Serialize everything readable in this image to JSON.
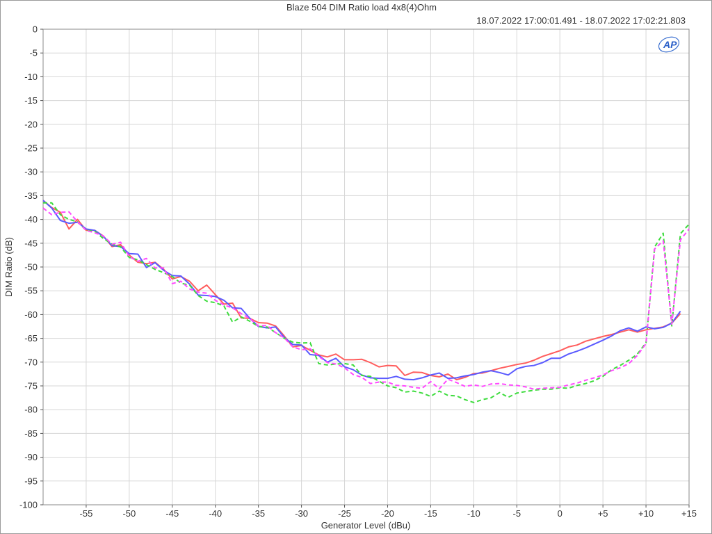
{
  "chart_data": {
    "type": "line",
    "title": "Blaze 504 DIM Ratio load 4x8(4)Ohm",
    "subtitle": "18.07.2022 17:00:01.491 - 18.07.2022 17:02:21.803",
    "xlabel": "Generator Level (dBu)",
    "ylabel": "DIM Ratio (dB)",
    "xlim": [
      -60,
      15
    ],
    "ylim": [
      -100,
      0
    ],
    "grid": true,
    "xticks": [
      -55,
      -50,
      -45,
      -40,
      -35,
      -30,
      -25,
      -20,
      -15,
      -10,
      -5,
      0,
      5,
      10,
      15
    ],
    "xtick_labels": [
      "-55",
      "-50",
      "-45",
      "-40",
      "-35",
      "-30",
      "-25",
      "-20",
      "-15",
      "-10",
      "-5",
      "0",
      "+5",
      "+10",
      "+15"
    ],
    "yticks": [
      0,
      -5,
      -10,
      -15,
      -20,
      -25,
      -30,
      -35,
      -40,
      -45,
      -50,
      -55,
      -60,
      -65,
      -70,
      -75,
      -80,
      -85,
      -90,
      -95,
      -100
    ],
    "ytick_labels": [
      "0",
      "-5",
      "-10",
      "-15",
      "-20",
      "-25",
      "-30",
      "-35",
      "-40",
      "-45",
      "-50",
      "-55",
      "-60",
      "-65",
      "-70",
      "-75",
      "-80",
      "-85",
      "-90",
      "-95",
      "-100"
    ],
    "series": [
      {
        "color": "#ff5d5d",
        "dash": false,
        "x": [
          -60,
          -59,
          -58,
          -57,
          -56,
          -55,
          -54,
          -53,
          -52,
          -51,
          -50,
          -49,
          -48,
          -47,
          -46,
          -45,
          -44,
          -43,
          -42,
          -41,
          -40,
          -39,
          -38,
          -37,
          -36,
          -35,
          -34,
          -33,
          -32,
          -31,
          -30,
          -29,
          -28,
          -27,
          -26,
          -25,
          -24,
          -23,
          -22,
          -21,
          -20,
          -19,
          -18,
          -17,
          -16,
          -15,
          -14,
          -13,
          -12,
          -11,
          -10,
          -9,
          -8,
          -7,
          -6,
          -5,
          -4,
          -3,
          -2,
          -1,
          0,
          1,
          2,
          3,
          4,
          5,
          6,
          7,
          8,
          9,
          10,
          11,
          12,
          13,
          14
        ],
        "y": [
          -36,
          -37.5,
          -38.5,
          -42,
          -40,
          -42.3,
          -42.3,
          -43.5,
          -45.7,
          -45.3,
          -47.5,
          -49,
          -49.3,
          -49,
          -50.5,
          -52.5,
          -52,
          -53,
          -55,
          -53.8,
          -55.8,
          -57.8,
          -57.6,
          -60.7,
          -60.8,
          -61.7,
          -61.8,
          -62.4,
          -64.5,
          -66.8,
          -66.5,
          -67.5,
          -68.5,
          -68.9,
          -68.3,
          -69.5,
          -69.5,
          -69.4,
          -70.1,
          -71,
          -70.7,
          -70.8,
          -72.8,
          -72.1,
          -72.2,
          -72.8,
          -73.1,
          -72.5,
          -73.7,
          -73.2,
          -72.4,
          -72.3,
          -71.8,
          -71.3,
          -70.9,
          -70.5,
          -70.2,
          -69.6,
          -68.8,
          -68.2,
          -67.6,
          -66.8,
          -66.4,
          -65.6,
          -65.1,
          -64.6,
          -64.2,
          -63.7,
          -63.2,
          -63.7,
          -63.2,
          -62.9,
          -62.6,
          -61.8,
          -59.8
        ]
      },
      {
        "color": "#5b5bff",
        "dash": false,
        "x": [
          -60,
          -59,
          -58,
          -57,
          -56,
          -55,
          -54,
          -53,
          -52,
          -51,
          -50,
          -49,
          -48,
          -47,
          -46,
          -45,
          -44,
          -43,
          -42,
          -41,
          -40,
          -39,
          -38,
          -37,
          -36,
          -35,
          -34,
          -33,
          -32,
          -31,
          -30,
          -29,
          -28,
          -27,
          -26,
          -25,
          -24,
          -23,
          -22,
          -21,
          -20,
          -19,
          -18,
          -17,
          -16,
          -15,
          -14,
          -13,
          -12,
          -11,
          -10,
          -9,
          -8,
          -7,
          -6,
          -5,
          -4,
          -3,
          -2,
          -1,
          0,
          1,
          2,
          3,
          4,
          5,
          6,
          7,
          8,
          9,
          10,
          11,
          12,
          13,
          14
        ],
        "y": [
          -36,
          -37.6,
          -40.2,
          -40.8,
          -40.6,
          -42,
          -42.3,
          -43.6,
          -45.5,
          -45.7,
          -47.2,
          -47.3,
          -50.1,
          -49.1,
          -50.7,
          -51.8,
          -51.9,
          -53.6,
          -55.9,
          -56,
          -56.2,
          -57,
          -58.6,
          -58.7,
          -60.8,
          -62.5,
          -62.8,
          -62.6,
          -64.8,
          -66.3,
          -66.4,
          -68.4,
          -68.6,
          -70,
          -69.2,
          -71,
          -71.6,
          -72.7,
          -73.3,
          -73.4,
          -73.4,
          -73,
          -73.6,
          -73.7,
          -73.3,
          -72.7,
          -72.3,
          -73.4,
          -73.3,
          -72.9,
          -72.6,
          -72.1,
          -71.8,
          -72.2,
          -72.7,
          -71.4,
          -70.9,
          -70.7,
          -70.1,
          -69.2,
          -69.2,
          -68.3,
          -67.7,
          -67,
          -66.2,
          -65.4,
          -64.5,
          -63.4,
          -62.8,
          -63.5,
          -62.6,
          -63,
          -62.7,
          -61.8,
          -59.3
        ]
      },
      {
        "color": "#3ddc3d",
        "dash": true,
        "x": [
          -60,
          -59,
          -58,
          -57,
          -56,
          -55,
          -54,
          -53,
          -52,
          -51,
          -50,
          -49,
          -48,
          -47,
          -46,
          -45,
          -44,
          -43,
          -42,
          -41,
          -40,
          -39,
          -38,
          -37,
          -36,
          -35,
          -34,
          -33,
          -32,
          -31,
          -30,
          -29,
          -28,
          -27,
          -26,
          -25,
          -24,
          -23,
          -22,
          -21,
          -20,
          -19,
          -18,
          -17,
          -16,
          -15,
          -14,
          -13,
          -12,
          -11,
          -10,
          -9,
          -8,
          -7,
          -6,
          -5,
          -4,
          -3,
          -2,
          -1,
          0,
          1,
          2,
          3,
          4,
          5,
          6,
          7,
          8,
          9,
          10,
          11,
          12,
          13,
          14,
          15
        ],
        "y": [
          -36.5,
          -36.5,
          -39,
          -40,
          -40.5,
          -42.3,
          -42.5,
          -44,
          -45.2,
          -45.8,
          -48,
          -48.5,
          -49.5,
          -50.5,
          -51.2,
          -52,
          -53.4,
          -53.8,
          -56,
          -57.2,
          -57.5,
          -58.2,
          -61.6,
          -60.5,
          -61.4,
          -62.5,
          -62.6,
          -63.8,
          -65,
          -65.8,
          -66,
          -65.9,
          -70.3,
          -70.6,
          -70.4,
          -70.3,
          -70.6,
          -72.8,
          -73,
          -74,
          -75,
          -75.4,
          -76.3,
          -76.1,
          -76.5,
          -77.2,
          -76.1,
          -77,
          -77.1,
          -77.9,
          -78.5,
          -77.9,
          -77.5,
          -76.4,
          -77.4,
          -76.5,
          -76.2,
          -75.9,
          -75.7,
          -75.7,
          -75.4,
          -75.5,
          -74.9,
          -74.5,
          -73.9,
          -73,
          -71.6,
          -70.7,
          -69.6,
          -68.3,
          -65.9,
          -45.8,
          -42.9,
          -62.4,
          -43,
          -41
        ]
      },
      {
        "color": "#ff4aff",
        "dash": true,
        "x": [
          -60,
          -59,
          -58,
          -57,
          -56,
          -55,
          -54,
          -53,
          -52,
          -51,
          -50,
          -49,
          -48,
          -47,
          -46,
          -45,
          -44,
          -43,
          -42,
          -41,
          -40,
          -39,
          -38,
          -37,
          -36,
          -35,
          -34,
          -33,
          -32,
          -31,
          -30,
          -29,
          -28,
          -27,
          -26,
          -25,
          -24,
          -23,
          -22,
          -21,
          -20,
          -19,
          -18,
          -17,
          -16,
          -15,
          -14,
          -13,
          -12,
          -11,
          -10,
          -9,
          -8,
          -7,
          -6,
          -5,
          -4,
          -3,
          -2,
          -1,
          0,
          1,
          2,
          3,
          4,
          5,
          6,
          7,
          8,
          9,
          10,
          11,
          12,
          13,
          14,
          15
        ],
        "y": [
          -37.6,
          -39,
          -38.5,
          -38.4,
          -40.5,
          -42.3,
          -42.8,
          -43.5,
          -45.2,
          -44.8,
          -47.8,
          -48.8,
          -48.2,
          -50.2,
          -50.2,
          -53.5,
          -53,
          -54.6,
          -55.3,
          -55.5,
          -57,
          -58,
          -58.6,
          -59.8,
          -60.8,
          -62.4,
          -62.3,
          -63.8,
          -64.9,
          -66.8,
          -67.4,
          -67.2,
          -68.8,
          -70.1,
          -70.4,
          -71.2,
          -72.6,
          -73.2,
          -74.5,
          -74.2,
          -74.2,
          -74.9,
          -75,
          -75.3,
          -75.5,
          -74.1,
          -75.6,
          -73.6,
          -74.3,
          -75.1,
          -74.8,
          -75.1,
          -74.6,
          -74.5,
          -74.8,
          -74.9,
          -75.2,
          -75.7,
          -75.5,
          -75.4,
          -75.3,
          -74.8,
          -74.4,
          -73.8,
          -73.3,
          -72.7,
          -71.8,
          -71.2,
          -70.3,
          -68.6,
          -66.1,
          -46.2,
          -44.5,
          -62,
          -44.3,
          -42
        ]
      }
    ]
  }
}
